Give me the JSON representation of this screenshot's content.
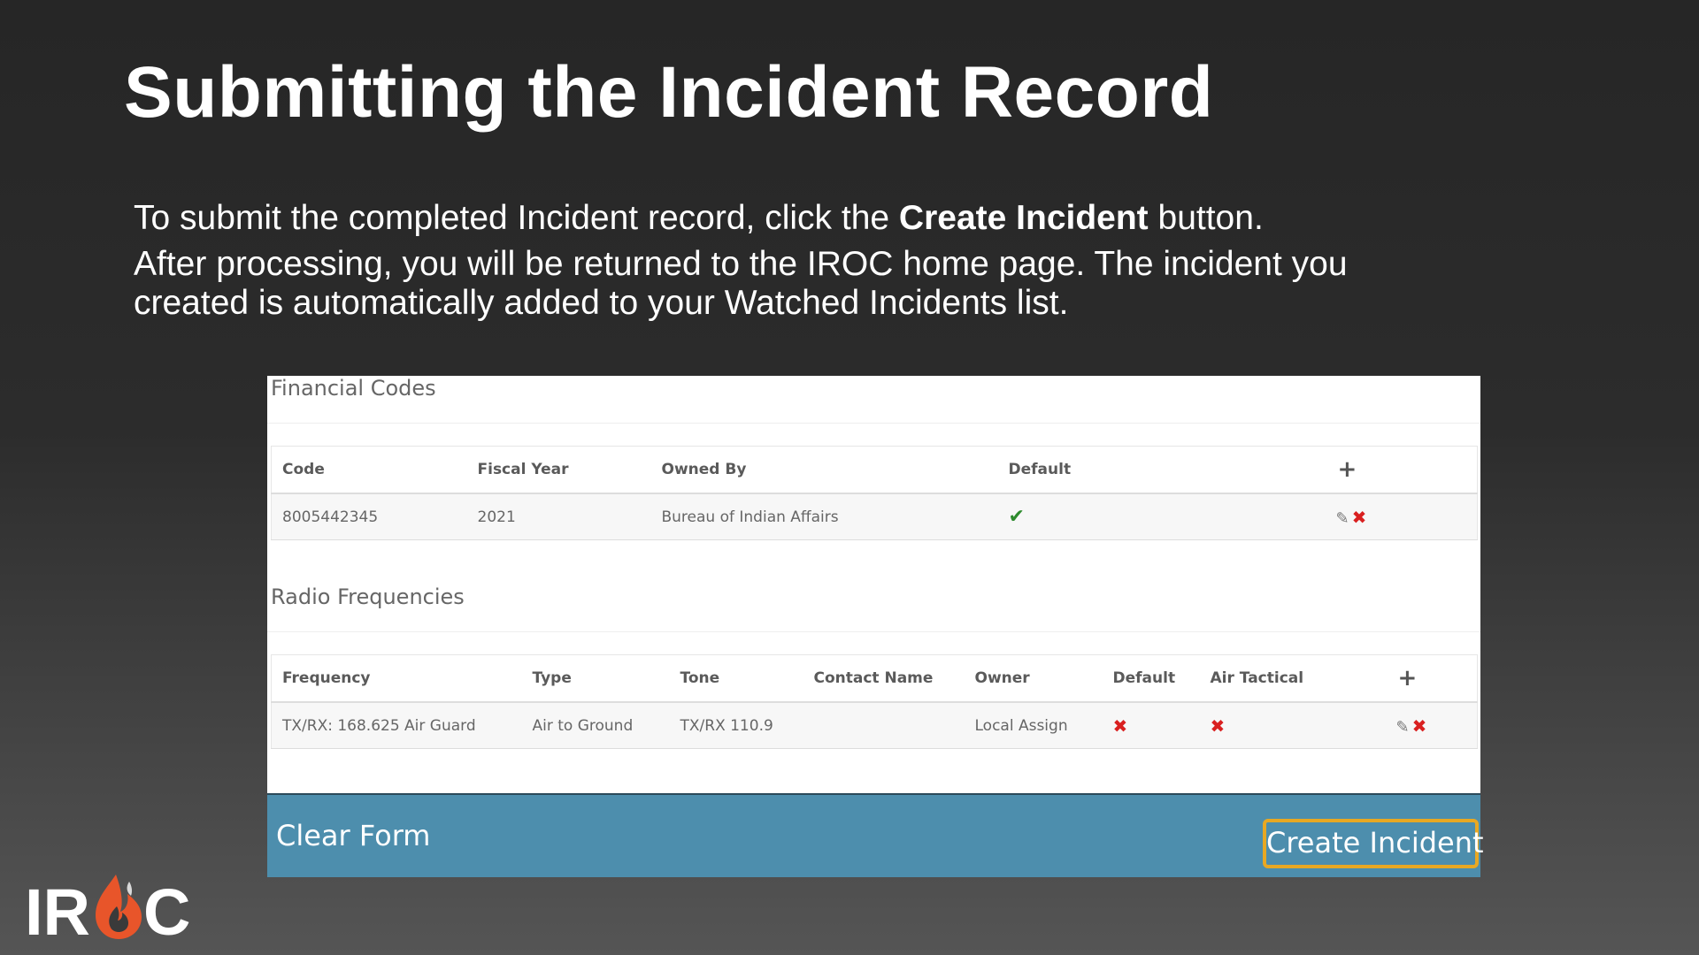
{
  "slide": {
    "title": "Submitting the Incident Record",
    "para1_pre": "To submit the completed Incident record, click the ",
    "para1_bold": "Create Incident",
    "para1_post": " button.",
    "para2": "After processing, you will be returned to the IROC home page. The incident you created is automatically added to your Watched Incidents list."
  },
  "financial": {
    "title": "Financial Codes",
    "headers": [
      "Code",
      "Fiscal Year",
      "Owned By",
      "Default",
      "+"
    ],
    "row": {
      "code": "8005442345",
      "fiscal_year": "2021",
      "owned_by": "Bureau of Indian Affairs",
      "default": "check-icon"
    }
  },
  "radio": {
    "title": "Radio Frequencies",
    "headers": [
      "Frequency",
      "Type",
      "Tone",
      "Contact Name",
      "Owner",
      "Default",
      "Air Tactical",
      "+"
    ],
    "row": {
      "frequency": "TX/RX: 168.625 Air Guard",
      "type": "Air to Ground",
      "tone": "TX/RX 110.9",
      "contact_name": "",
      "owner": "Local Assign",
      "default": "x-icon",
      "air_tactical": "x-icon"
    }
  },
  "actions": {
    "clear_label": "Clear Form",
    "create_label": "Create Incident"
  },
  "logo": {
    "text_left": "IR",
    "text_right": "C"
  },
  "colors": {
    "action_bar": "#4d8ead",
    "highlight": "#e8a823",
    "flame": "#e8552a"
  }
}
